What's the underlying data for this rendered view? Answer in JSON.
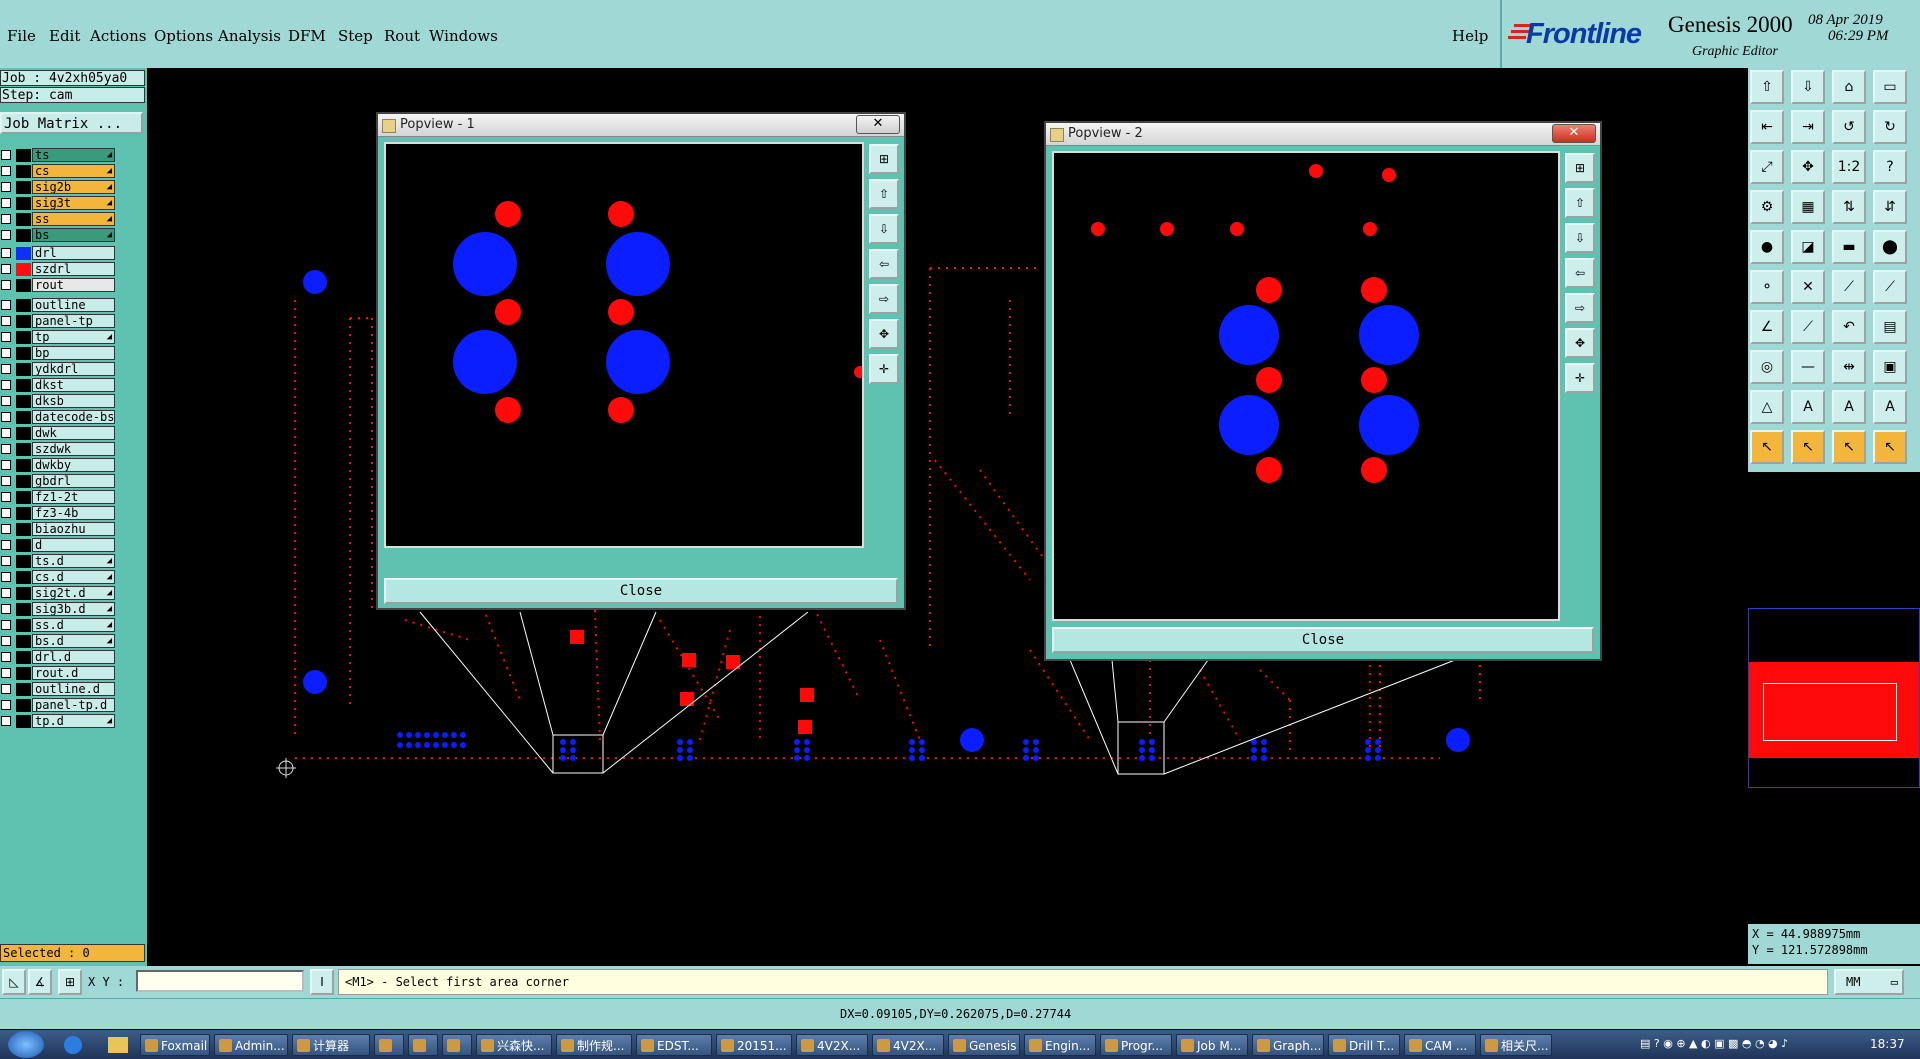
{
  "menu": [
    "File",
    "Edit",
    "Actions",
    "Options",
    "Analysis",
    "DFM",
    "Step",
    "Rout",
    "Windows"
  ],
  "help": "Help",
  "brand": {
    "logo": "Frontline",
    "product": "Genesis 2000",
    "date": "08 Apr 2019",
    "time": "06:29 PM",
    "subtitle": "Graphic Editor"
  },
  "job": {
    "job_line": "Job : 4v2xh05ya0",
    "step_line": "Step: cam",
    "matrix_button": "Job Matrix ..."
  },
  "layers_board": [
    {
      "name": "ts",
      "color": "#5fc2b0",
      "bg": "#3a9a7c",
      "mark": "◢"
    },
    {
      "name": "cs",
      "color": "#f4b63a",
      "bg": "#f2b63c",
      "mark": "◢"
    },
    {
      "name": "sig2b",
      "color": "#f4b63a",
      "bg": "#f2b63c",
      "mark": "◢"
    },
    {
      "name": "sig3t",
      "color": "#f4b63a",
      "bg": "#f2b63c",
      "mark": "◢"
    },
    {
      "name": "ss",
      "color": "#f4b63a",
      "bg": "#f2b63c",
      "mark": "◢"
    },
    {
      "name": "bs",
      "color": "#5fc2b0",
      "bg": "#3a9a7c",
      "mark": "◢"
    }
  ],
  "layers_drill": [
    {
      "name": "drl",
      "swatch": "#1030ff",
      "bg": "#c8ece8"
    },
    {
      "name": "szdrl",
      "swatch": "#ff1010",
      "bg": "#c8ece8"
    },
    {
      "name": "rout",
      "swatch": "#000000",
      "bg": "#e8e8e8"
    }
  ],
  "layers_misc": [
    {
      "name": "outline",
      "mark": ""
    },
    {
      "name": "panel-tp",
      "mark": ""
    },
    {
      "name": "tp",
      "mark": "◢"
    },
    {
      "name": "bp",
      "mark": ""
    },
    {
      "name": "ydkdrl",
      "mark": ""
    },
    {
      "name": "dkst",
      "mark": ""
    },
    {
      "name": "dksb",
      "mark": ""
    },
    {
      "name": "datecode-bs",
      "mark": ""
    },
    {
      "name": "dwk",
      "mark": ""
    },
    {
      "name": "szdwk",
      "mark": ""
    },
    {
      "name": "dwkby",
      "mark": ""
    },
    {
      "name": "gbdrl",
      "mark": ""
    },
    {
      "name": "fz1-2t",
      "mark": ""
    },
    {
      "name": "fz3-4b",
      "mark": ""
    },
    {
      "name": "biaozhu",
      "mark": ""
    },
    {
      "name": "d",
      "mark": ""
    },
    {
      "name": "ts.d",
      "mark": "◢"
    },
    {
      "name": "cs.d",
      "mark": "◢"
    },
    {
      "name": "sig2t.d",
      "mark": "◢"
    },
    {
      "name": "sig3b.d",
      "mark": "◢"
    },
    {
      "name": "ss.d",
      "mark": "◢"
    },
    {
      "name": "bs.d",
      "mark": "◢"
    },
    {
      "name": "drl.d",
      "mark": ""
    },
    {
      "name": "rout.d",
      "mark": ""
    },
    {
      "name": "outline.d",
      "mark": ""
    },
    {
      "name": "panel-tp.d",
      "mark": ""
    },
    {
      "name": "tp.d",
      "mark": "◢"
    }
  ],
  "selected": "Selected : 0",
  "popview1": {
    "title": "Popview - 1",
    "close_x": "✕",
    "close_label": "Close"
  },
  "popview2": {
    "title": "Popview - 2",
    "close_x": "✕",
    "close_label": "Close"
  },
  "coords": {
    "x": "X = 44.98897​mm",
    "y": "Y = 121.57289​8mm"
  },
  "coords_text": {
    "x": "X = 44.988975mm",
    "y": "Y = 121.572898mm"
  },
  "cmd": {
    "xy_label": "X Y :",
    "xy_value": "",
    "prompt": "<M1> - Select first area corner",
    "units": "MM"
  },
  "status": "DX=0.09105,DY=0.262075,D=0.27744",
  "taskbar": {
    "items": [
      "Foxmail",
      "Admin...",
      "计算器",
      "",
      "",
      "",
      "兴森快...",
      "制作规...",
      "EDST...",
      "20151...",
      "4V2X...",
      "4V2X...",
      "Genesis",
      "Engin...",
      "Progr...",
      "Job M...",
      "Graph...",
      "Drill T...",
      "CAM ...",
      "相关尺..."
    ],
    "clock": "18:37"
  },
  "colors": {
    "pad_red": "#ff0a0a",
    "pad_blue": "#0a1eff",
    "panel_teal": "#5fc2b0",
    "menu_teal": "#9fd8d5"
  }
}
